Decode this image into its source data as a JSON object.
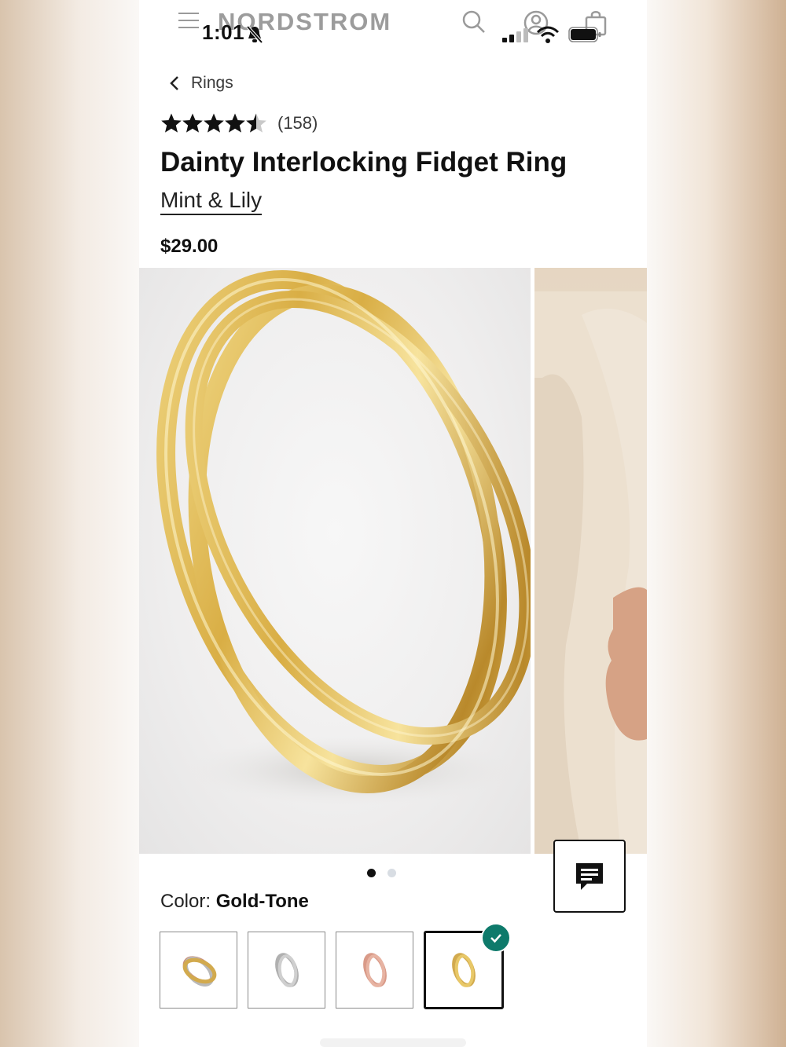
{
  "status_bar": {
    "time": "1:01"
  },
  "header": {
    "brand": "NORDSTROM",
    "icons": [
      "menu-icon",
      "search-icon",
      "account-icon",
      "shopping-bag-icon"
    ]
  },
  "breadcrumb": {
    "label": "Rings"
  },
  "product": {
    "rating_stars": 4.5,
    "rating_max": 5,
    "rating_count": "(158)",
    "title": "Dainty Interlocking Fidget Ring",
    "brand": "Mint & Lily",
    "price": "$29.00"
  },
  "gallery": {
    "slide_count": 2,
    "active_index": 0
  },
  "color": {
    "label": "Color:",
    "selected": "Gold-Tone",
    "swatches": [
      {
        "name": "Tri-Tone"
      },
      {
        "name": "Silver-Tone"
      },
      {
        "name": "Rose Gold-Tone"
      },
      {
        "name": "Gold-Tone",
        "selected": true
      }
    ]
  },
  "colors": {
    "accent_check": "#0e7a6b",
    "text": "#111111"
  }
}
